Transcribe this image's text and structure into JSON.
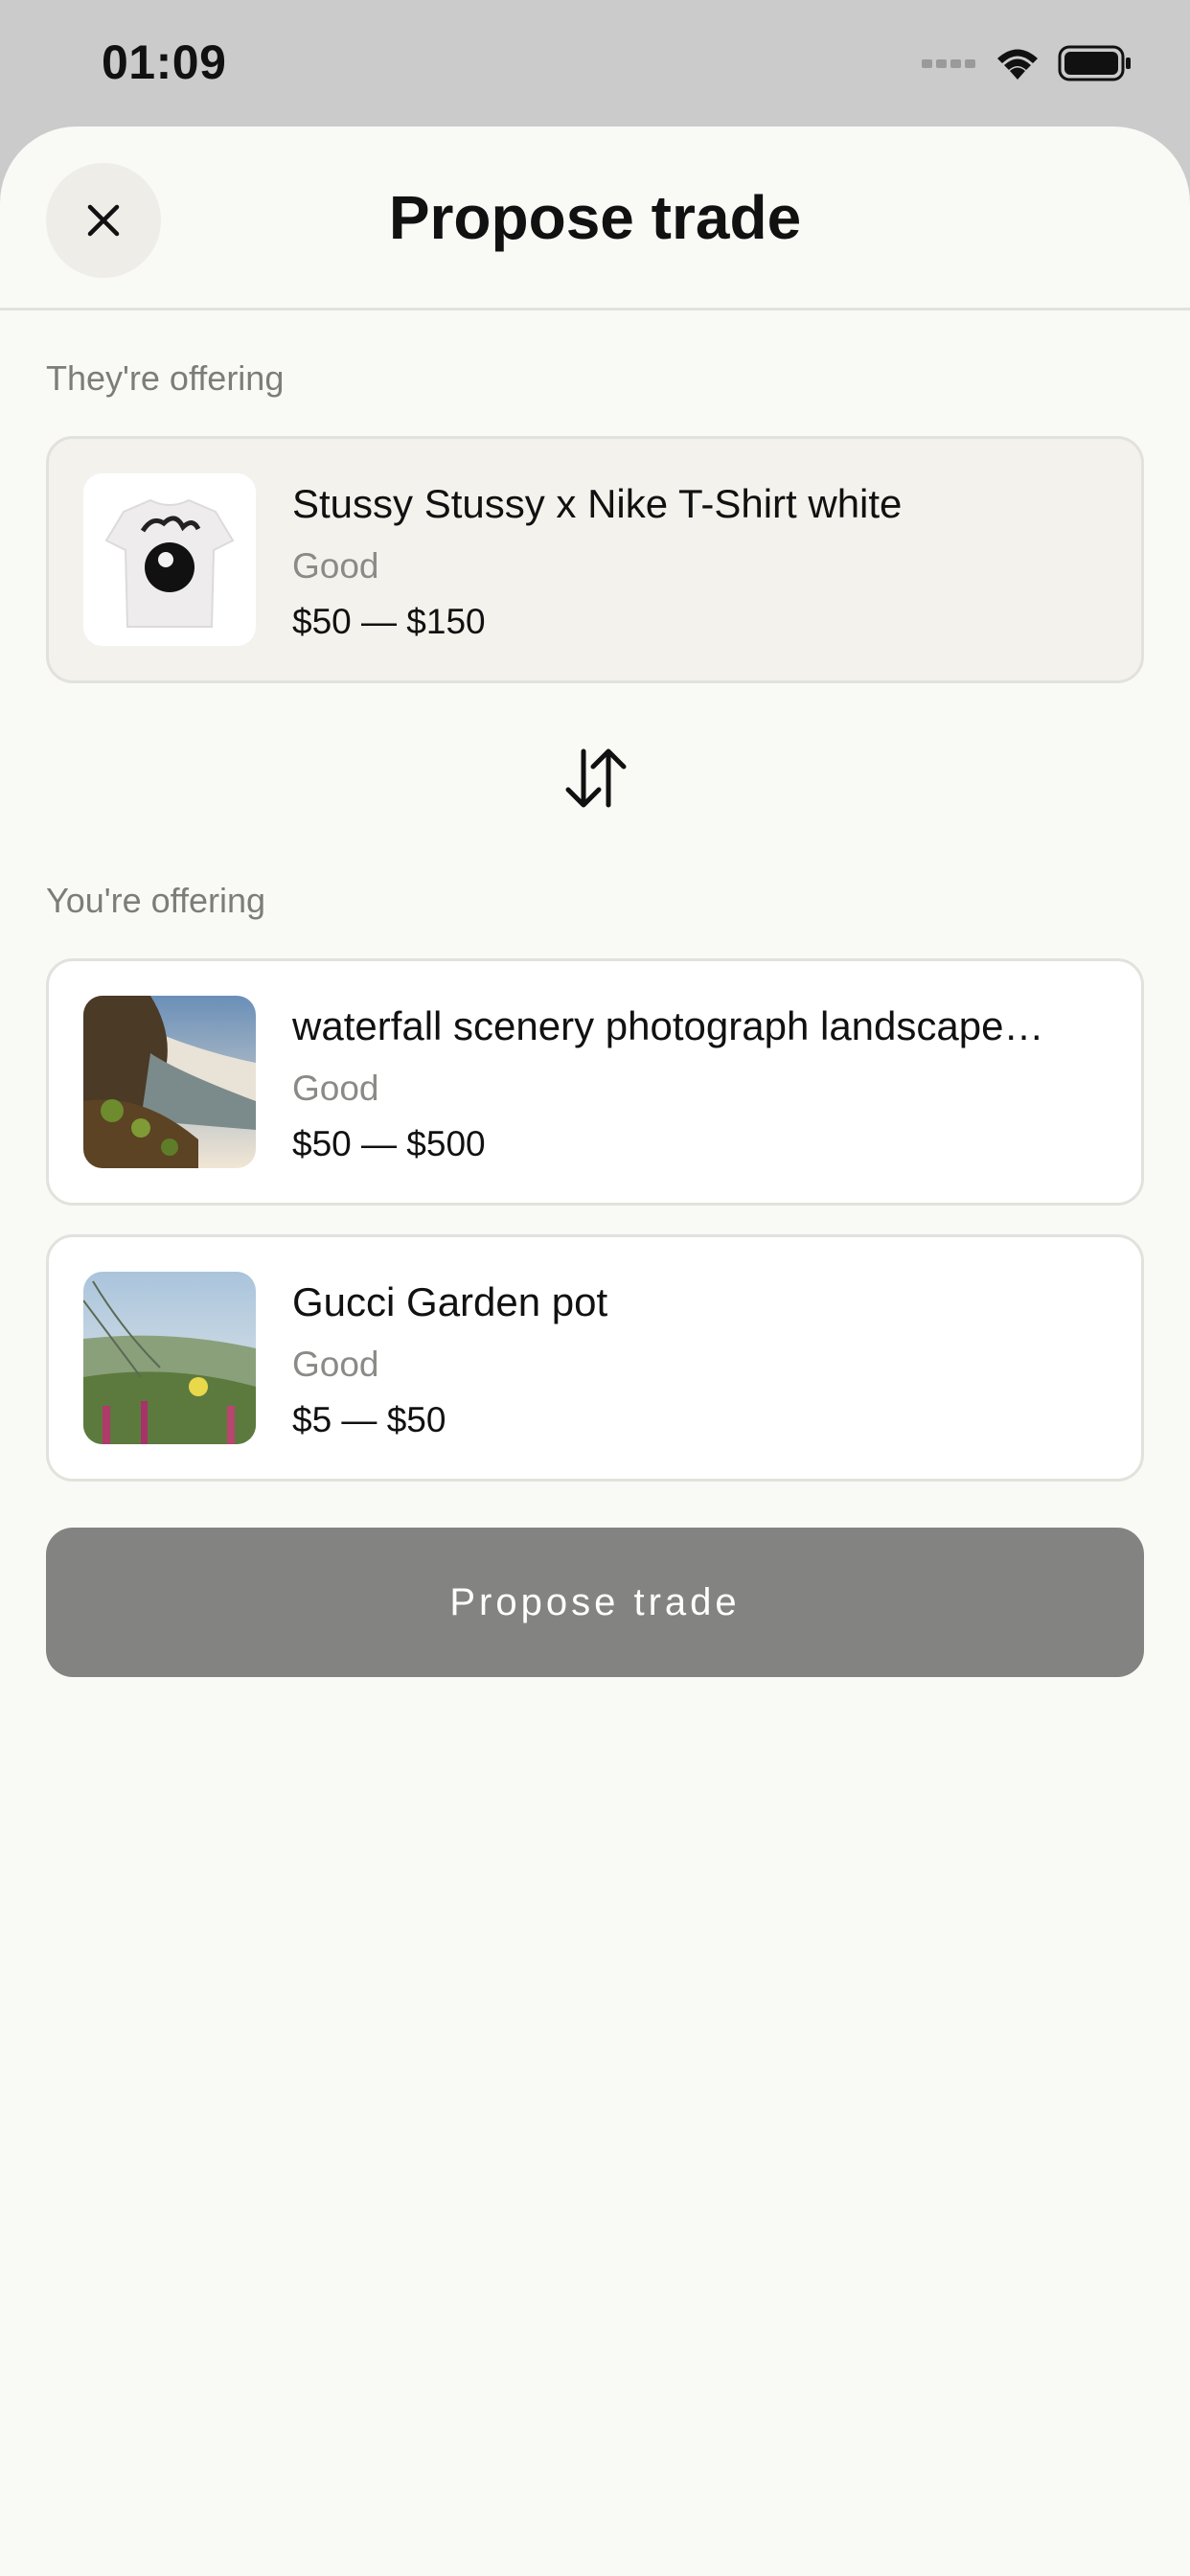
{
  "status_bar": {
    "time": "01:09"
  },
  "header": {
    "title": "Propose trade",
    "close_icon": "close-icon"
  },
  "theirs": {
    "label": "They're offering",
    "item": {
      "title": "Stussy Stussy x Nike T-Shirt white",
      "condition": "Good",
      "price": "$50 — $150",
      "thumb": "tshirt-image"
    }
  },
  "swap_icon": "swap-arrows-icon",
  "yours": {
    "label": "You're offering",
    "items": [
      {
        "title": "waterfall scenery photograph landscape…",
        "condition": "Good",
        "price": "$50 — $500",
        "thumb": "waterfall-image"
      },
      {
        "title": "Gucci Garden pot",
        "condition": "Good",
        "price": "$5 — $50",
        "thumb": "garden-image"
      }
    ]
  },
  "action": {
    "label": "Propose trade"
  },
  "colors": {
    "sheet_bg": "#f9f9f6",
    "button_disabled": "#838381",
    "muted_text": "#8a8a86"
  }
}
